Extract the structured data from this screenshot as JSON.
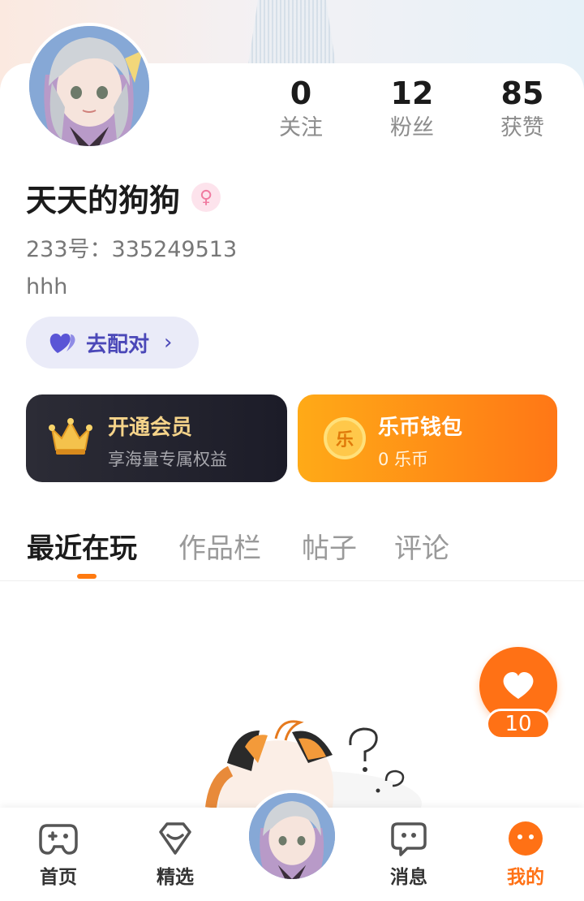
{
  "profile": {
    "name": "天天的狗狗",
    "gender_symbol": "♀",
    "uid": "233号：335249513",
    "bio": "hhh"
  },
  "stats": [
    {
      "value": "0",
      "label": "关注"
    },
    {
      "value": "12",
      "label": "粉丝"
    },
    {
      "value": "85",
      "label": "获赞"
    }
  ],
  "match_button": {
    "label": "去配对",
    "chevron": "›"
  },
  "vip_card": {
    "title": "开通会员",
    "subtitle": "享海量专属权益"
  },
  "wallet_card": {
    "coin_glyph": "乐",
    "title": "乐币钱包",
    "subtitle": "0 乐币"
  },
  "tabs": [
    {
      "label": "最近在玩",
      "active": true
    },
    {
      "label": "作品栏",
      "active": false
    },
    {
      "label": "帖子",
      "active": false
    },
    {
      "label": "评论",
      "active": false
    }
  ],
  "like_fab": {
    "count": "10"
  },
  "bottom_nav": [
    {
      "label": "首页",
      "icon": "gamepad-icon",
      "active": false
    },
    {
      "label": "精选",
      "icon": "heart-gem-icon",
      "active": false
    },
    {
      "label": "",
      "icon": "avatar",
      "active": false
    },
    {
      "label": "消息",
      "icon": "chat-icon",
      "active": false
    },
    {
      "label": "我的",
      "icon": "profile-face-icon",
      "active": true
    }
  ],
  "colors": {
    "accent": "#ff7115",
    "match_text": "#4b48b8",
    "vip_gold": "#f6d48a",
    "vip_bg": "#24242f"
  }
}
